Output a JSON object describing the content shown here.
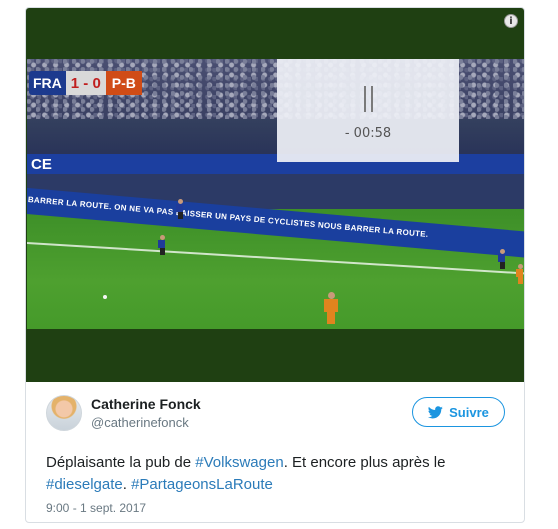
{
  "media": {
    "info_icon": "info-icon",
    "scoreboard": {
      "home": "FRA",
      "score": "1 - 0",
      "away": "P-B"
    },
    "board_partial_text": "CE",
    "ad_board_text": "BARRER LA ROUTE.   ON NE VA PAS LAISSER UN PAYS DE CYCLISTES NOUS BARRER LA ROUTE.",
    "player_state": {
      "icon": "pause-icon",
      "time_remaining": "- 00:58"
    }
  },
  "author": {
    "name": "Catherine Fonck",
    "handle": "@catherinefonck",
    "avatar": "avatar-photo"
  },
  "follow_button": {
    "icon": "twitter-bird-icon",
    "label": "Suivre"
  },
  "tweet": {
    "text_1": "Déplaisante la pub de ",
    "hashtag_1": "#Volkswagen",
    "text_2": ". Et encore plus après le ",
    "hashtag_2": "#dieselgate",
    "text_3": ". ",
    "hashtag_3": "#PartageonsLaRoute",
    "timestamp": "9:00 - 1 sept. 2017"
  },
  "colors": {
    "link": "#2b7bb9",
    "follow_accent": "#1b95e0",
    "text": "#1c2022",
    "muted": "#697882",
    "media_background": "#1f4012"
  }
}
